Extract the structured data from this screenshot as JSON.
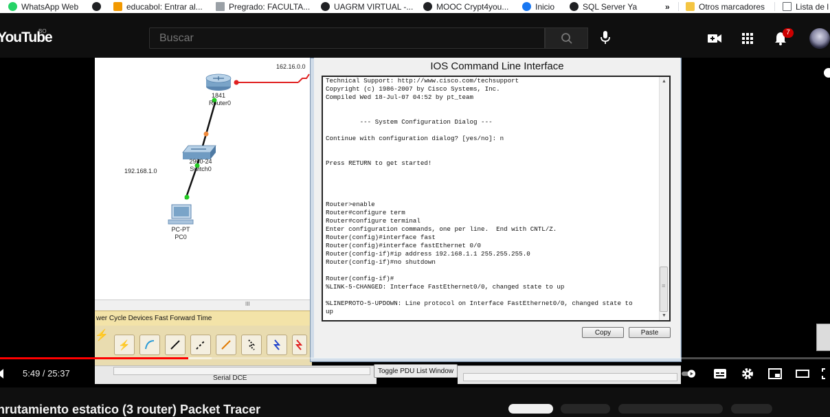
{
  "bookmarks": {
    "items": [
      {
        "label": "WhatsApp Web",
        "color": "#25d366"
      },
      {
        "label": "",
        "color": "#202124"
      },
      {
        "label": "educabol: Entrar al...",
        "color": "#f29900"
      },
      {
        "label": "Pregrado: FACULTA...",
        "color": "#9aa0a6"
      },
      {
        "label": "UAGRM VIRTUAL -...",
        "color": "#202124"
      },
      {
        "label": "MOOC Crypt4you...",
        "color": "#202124"
      },
      {
        "label": "Inicio",
        "color": "#1877f2"
      },
      {
        "label": "SQL Server Ya",
        "color": "#202124"
      }
    ],
    "more": "»",
    "other_label": "Otros marcadores",
    "reading_list_label": "Lista de l"
  },
  "youtube": {
    "logo_text": "YouTube",
    "country_code": "BO",
    "search_placeholder": "Buscar",
    "notification_count": "7",
    "brand_color": "#ff0000"
  },
  "packet_tracer": {
    "network_label_top": "162.16.0.0",
    "network_label_left": "192.168.1.0",
    "router": {
      "model": "1841",
      "name": "Router0"
    },
    "switch": {
      "model": "2960-24",
      "name": "Switch0"
    },
    "pc": {
      "model": "PC-PT",
      "name": "PC0"
    },
    "hscroll_marker": "III",
    "toolbar_text": "wer Cycle Devices  Fast Forward Time",
    "connection_type": "Serial DCE",
    "toggle_pdu_label": "Toggle PDU List Window"
  },
  "ios_cli": {
    "title": "IOS Command Line Interface",
    "console_text": "Technical Support: http://www.cisco.com/techsupport\nCopyright (c) 1986-2007 by Cisco Systems, Inc.\nCompiled Wed 18-Jul-07 04:52 by pt_team\n\n\n         --- System Configuration Dialog ---\n\nContinue with configuration dialog? [yes/no]: n\n\n\nPress RETURN to get started!\n\n\n\n\nRouter>enable\nRouter#configure term\nRouter#configure terminal\nEnter configuration commands, one per line.  End with CNTL/Z.\nRouter(config)#interface fast\nRouter(config)#interface fastEthernet 0/0\nRouter(config-if)#ip address 192.168.1.1 255.255.255.0\nRouter(config-if)#no shutdown\n\nRouter(config-if)#\n%LINK-5-CHANGED: Interface FastEthernet0/0, changed state to up\n\n%LINEPROTO-5-UPDOWN: Line protocol on Interface FastEthernet0/0, changed state to\nup\n\nRouter(config-if)#",
    "copy_label": "Copy",
    "paste_label": "Paste",
    "scroll_marker": "III"
  },
  "player": {
    "time": "5:49 / 25:37",
    "progress_fraction": 0.227,
    "buffer_fraction": 0.255,
    "video_title": "nrutamiento estatico (3 router) Packet Tracer"
  }
}
